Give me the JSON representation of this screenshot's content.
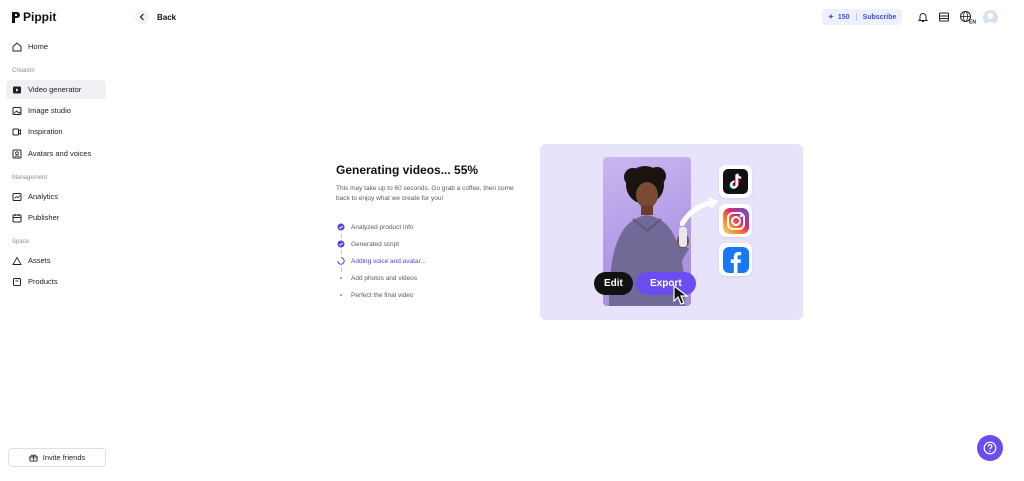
{
  "app": {
    "name": "Pippit"
  },
  "sidebar": {
    "home": "Home",
    "sections": {
      "creation": "Creation",
      "management": "Management",
      "space": "Space"
    },
    "creation_items": [
      {
        "label": "Video generator",
        "icon": "video-generator-icon",
        "active": true
      },
      {
        "label": "Image studio",
        "icon": "image-studio-icon"
      },
      {
        "label": "Inspiration",
        "icon": "inspiration-icon"
      },
      {
        "label": "Avatars and voices",
        "icon": "avatar-icon"
      }
    ],
    "management_items": [
      {
        "label": "Analytics",
        "icon": "analytics-icon"
      },
      {
        "label": "Publisher",
        "icon": "calendar-icon"
      }
    ],
    "space_items": [
      {
        "label": "Assets",
        "icon": "assets-icon"
      },
      {
        "label": "Products",
        "icon": "products-icon"
      }
    ],
    "invite_label": "Invite friends"
  },
  "header": {
    "back_label": "Back",
    "credits": "150",
    "subscribe_label": "Subscribe",
    "language": "EN"
  },
  "generation": {
    "title": "Generating videos... 55%",
    "progress_percent": 55,
    "subtitle": "This may take up to 60 seconds. Go grab a coffee, then come back to enjoy what we create for you!",
    "steps": [
      {
        "label": "Analyzed product info",
        "status": "done"
      },
      {
        "label": "Generated script",
        "status": "done"
      },
      {
        "label": "Adding voice and avatar...",
        "status": "in-progress"
      },
      {
        "label": "Add photos and videos",
        "status": "pending"
      },
      {
        "label": "Perfect the final video",
        "status": "pending"
      }
    ]
  },
  "promo": {
    "edit_label": "Edit",
    "export_label": "Export",
    "platforms": [
      "tiktok-icon",
      "instagram-icon",
      "facebook-icon"
    ]
  },
  "colors": {
    "accent": "#6a4cf0",
    "step_current": "#5b3ee0",
    "card_bg": "#e6e3fb"
  }
}
